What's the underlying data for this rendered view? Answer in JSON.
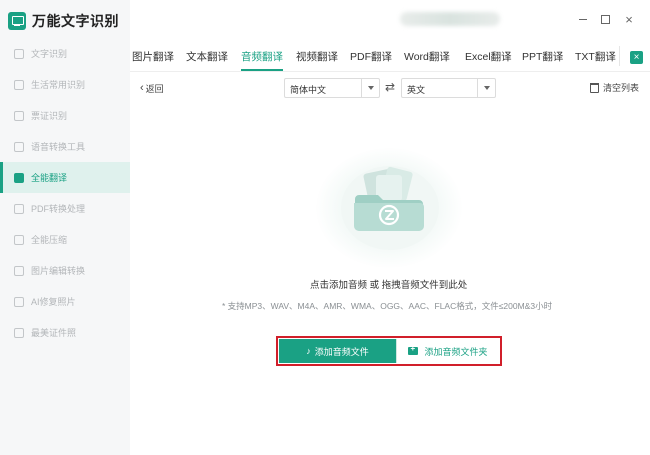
{
  "app": {
    "name": "万能文字识别"
  },
  "sidebar": {
    "items": [
      {
        "label": "文字识别",
        "icon": "text-recognition-icon"
      },
      {
        "label": "生活常用识别",
        "icon": "scan-icon"
      },
      {
        "label": "票证识别",
        "icon": "ticket-icon"
      },
      {
        "label": "语音转换工具",
        "icon": "voice-icon"
      },
      {
        "label": "全能翻译",
        "icon": "translate-icon",
        "active": true
      },
      {
        "label": "PDF转换处理",
        "icon": "pdf-icon"
      },
      {
        "label": "全能压缩",
        "icon": "compress-icon"
      },
      {
        "label": "图片编辑转换",
        "icon": "image-edit-icon"
      },
      {
        "label": "AI修复照片",
        "icon": "ai-photo-icon"
      },
      {
        "label": "最美证件照",
        "icon": "id-photo-icon"
      }
    ]
  },
  "window_controls": {
    "minimize": "minimize-icon",
    "maximize": "maximize-icon",
    "close": "×"
  },
  "tabs": [
    {
      "label": "图片翻译"
    },
    {
      "label": "文本翻译"
    },
    {
      "label": "音频翻译",
      "active": true
    },
    {
      "label": "视频翻译"
    },
    {
      "label": "PDF翻译"
    },
    {
      "label": "Word翻译"
    },
    {
      "label": "Excel翻译"
    },
    {
      "label": "PPT翻译"
    },
    {
      "label": "TXT翻译"
    }
  ],
  "tab_close": "×",
  "toolbar": {
    "back_chevron": "‹",
    "back_label": "返回",
    "source_language": "简体中文",
    "swap_glyph": "⇄",
    "target_language": "英文",
    "clear_label": "清空列表"
  },
  "dropzone": {
    "tip": "点击添加音频 或 拖拽音频文件到此处",
    "formats": "* 支持MP3、WAV、M4A、AMR、WMA、OGG、AAC、FLAC格式，文件≤200M&3小时"
  },
  "buttons": {
    "add_audio_glyph": "♪",
    "add_audio": "添加音频文件",
    "add_folder": "添加音频文件夹"
  },
  "colors": {
    "accent": "#1aa184",
    "highlight_frame": "#d11f2a",
    "sidebar_bg": "#f6f7f8"
  }
}
